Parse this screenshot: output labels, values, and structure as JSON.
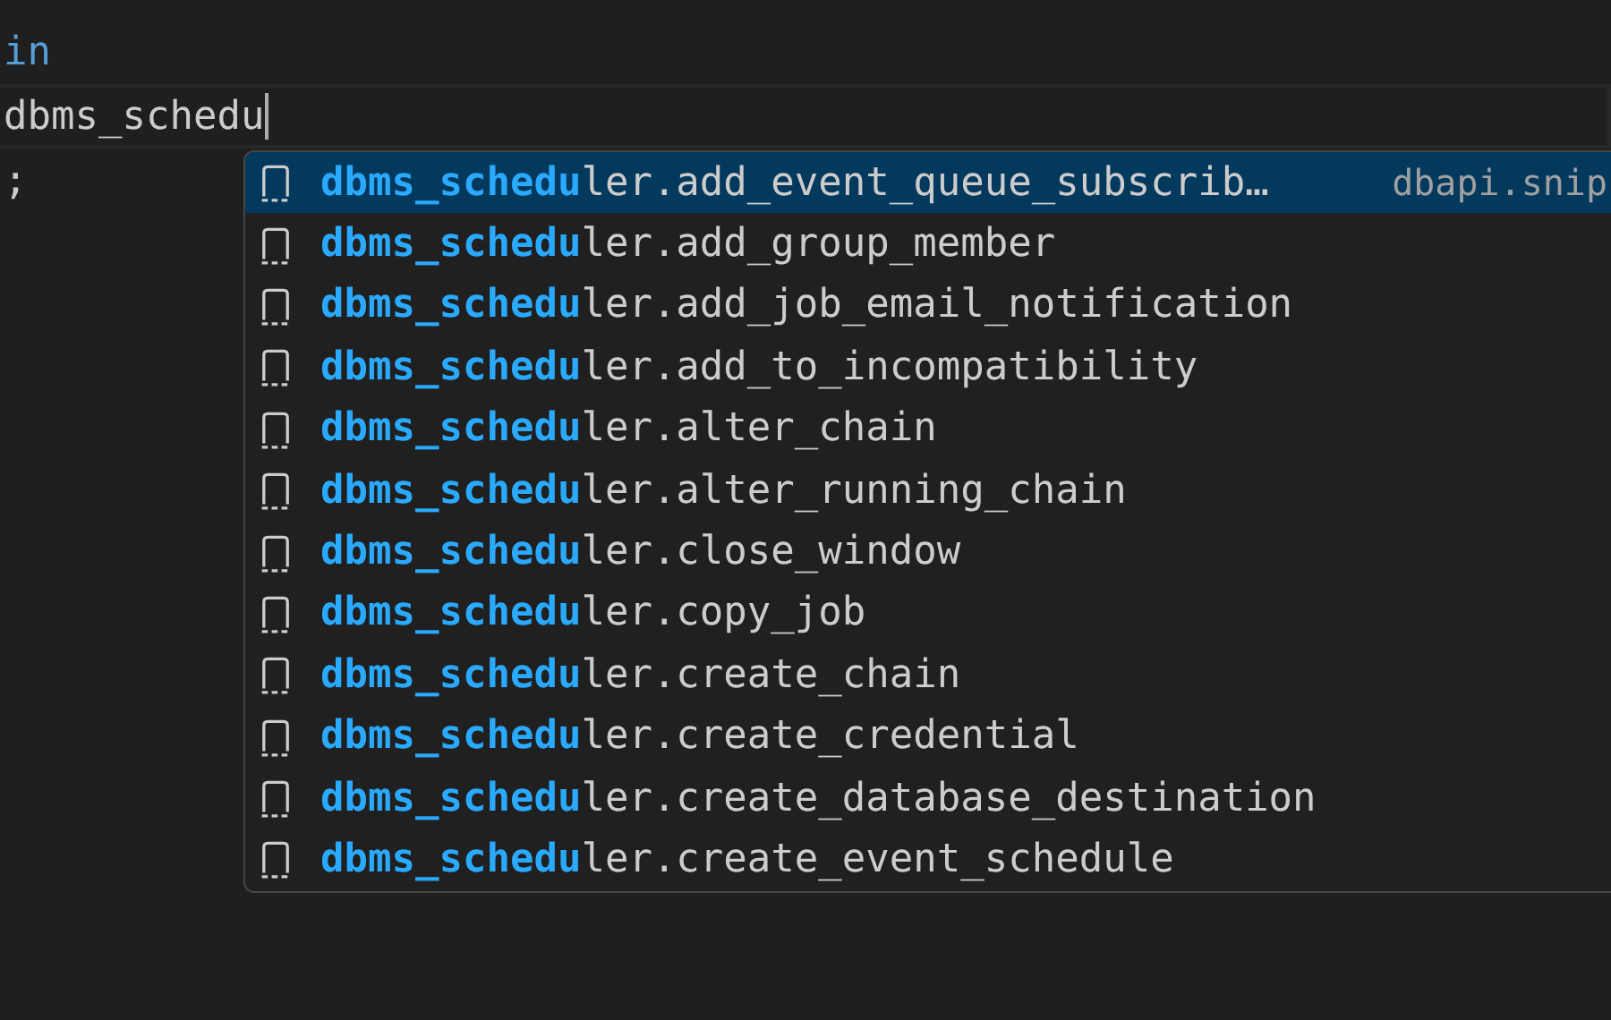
{
  "editor": {
    "lines": [
      {
        "text": "in",
        "kind": "keyword",
        "current": false
      },
      {
        "text": "dbms_schedu",
        "kind": "plain",
        "current": true
      },
      {
        "text": ";",
        "kind": "plain",
        "current": false
      }
    ]
  },
  "suggestions": {
    "items": [
      {
        "match": "dbms_schedu",
        "rest": "ler.add_event_queue_subscrib…",
        "detail": "dbapi.snip",
        "selected": true
      },
      {
        "match": "dbms_schedu",
        "rest": "ler.add_group_member",
        "selected": false
      },
      {
        "match": "dbms_schedu",
        "rest": "ler.add_job_email_notification",
        "selected": false
      },
      {
        "match": "dbms_schedu",
        "rest": "ler.add_to_incompatibility",
        "selected": false
      },
      {
        "match": "dbms_schedu",
        "rest": "ler.alter_chain",
        "selected": false
      },
      {
        "match": "dbms_schedu",
        "rest": "ler.alter_running_chain",
        "selected": false
      },
      {
        "match": "dbms_schedu",
        "rest": "ler.close_window",
        "selected": false
      },
      {
        "match": "dbms_schedu",
        "rest": "ler.copy_job",
        "selected": false
      },
      {
        "match": "dbms_schedu",
        "rest": "ler.create_chain",
        "selected": false
      },
      {
        "match": "dbms_schedu",
        "rest": "ler.create_credential",
        "selected": false
      },
      {
        "match": "dbms_schedu",
        "rest": "ler.create_database_destination",
        "selected": false
      },
      {
        "match": "dbms_schedu",
        "rest": "ler.create_event_schedule",
        "selected": false
      }
    ]
  }
}
